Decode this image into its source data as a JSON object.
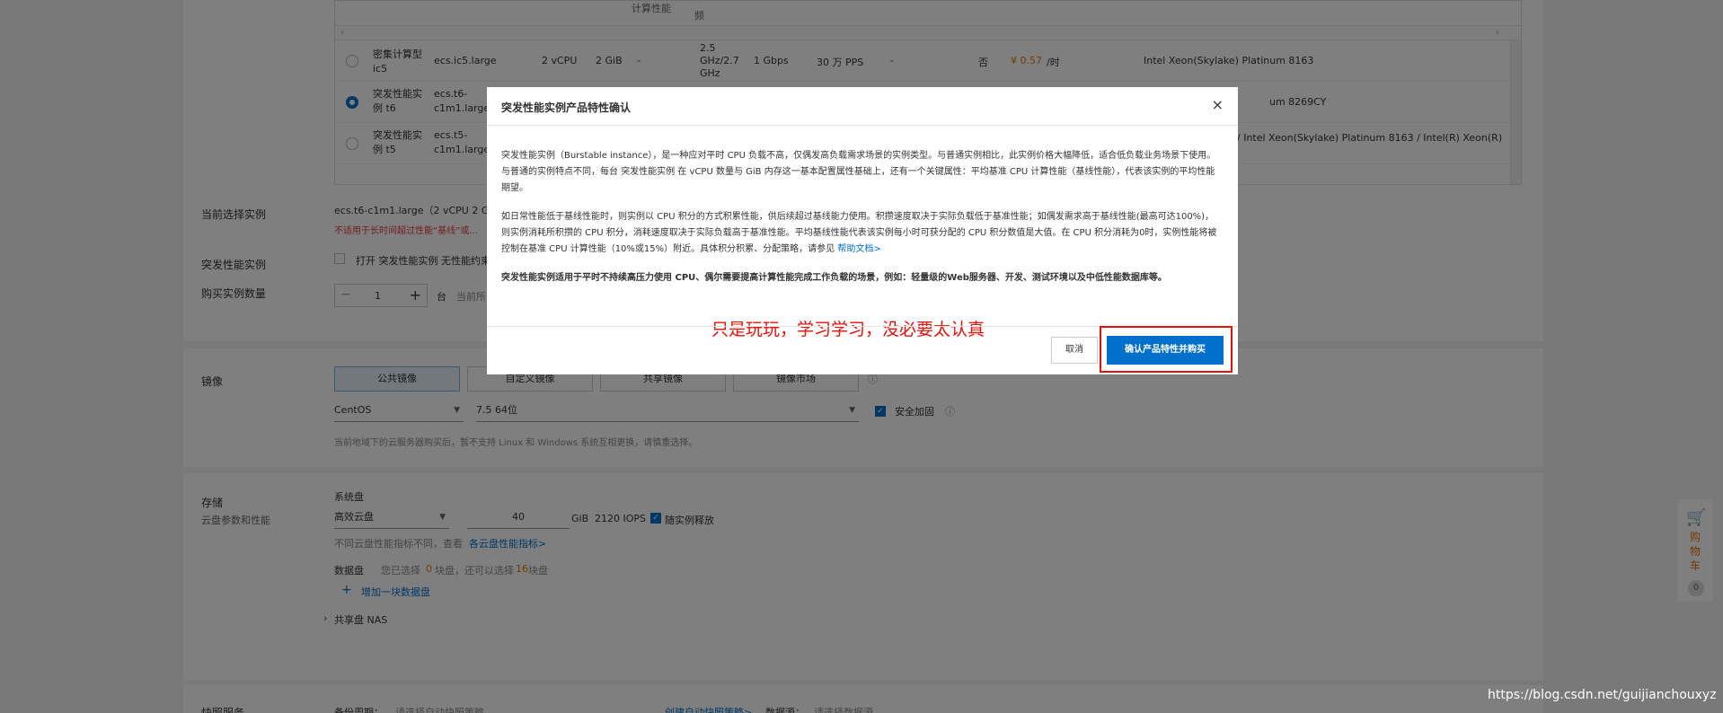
{
  "instances": {
    "header_cells": [
      "计算性能",
      "频"
    ],
    "rows": [
      {
        "name": "密集计算型 ic5",
        "spec": "ecs.ic5.large",
        "vcpu": "2 vCPU",
        "mem": "2 GiB",
        "gpu": "-",
        "freq": "2.5 GHz/2.7 GHz",
        "bw": "1 Gbps",
        "pps": "30 万 PPS",
        "extra": "-",
        "ipv6": "否",
        "price": "¥ 0.57",
        "unit": "/时",
        "cpu_model": "Intel Xeon(Skylake) Platinum 8163",
        "selected": false
      },
      {
        "name": "突发性能实例 t6",
        "spec": "ecs.t6-c1m1.large",
        "cpu_model": "um 8269CY",
        "selected": true
      },
      {
        "name": "突发性能实例 t5",
        "spec": "ecs.t5-c1m1.large",
        "cpu_model": "/ Intel Xeon(Skylake) Platinum 8163 / Intel(R) Xeon(R)",
        "selected": false
      }
    ]
  },
  "current_selection": {
    "label": "当前选择实例",
    "value": "ecs.t6-c1m1.large（2 vCPU 2 G",
    "warning": "不适用于长时间超过性能“基线”或..."
  },
  "burstable": {
    "label": "突发性能实例",
    "checkbox_label": "打开 突发性能实例 无性能约束"
  },
  "quantity": {
    "label": "购买实例数量",
    "value": "1",
    "unit": "台",
    "note": "当前所"
  },
  "image": {
    "label": "镜像",
    "tabs": [
      "公共镜像",
      "自定义镜像",
      "共享镜像",
      "镜像市场"
    ],
    "os": "CentOS",
    "version": "7.5 64位",
    "security_label": "安全加固",
    "note": "当前地域下的云服务器购买后，暂不支持 Linux 和 Windows 系统互相更换，请慎重选择。"
  },
  "storage": {
    "label": "存储",
    "sublabel": "云盘参数和性能",
    "system_disk": "系统盘",
    "disk_type": "高效云盘",
    "disk_size": "40",
    "disk_unit": "GiB",
    "iops": "2120 IOPS",
    "release_label": "随实例释放",
    "perf_note": "不同云盘性能指标不同，查看",
    "perf_link": "各云盘性能指标>",
    "data_disk": "数据盘",
    "data_disk_note_a": "您已选择",
    "data_disk_count": "0",
    "data_disk_note_b": "块盘，还可以选择",
    "data_disk_remaining": "16",
    "data_disk_note_c": "块盘",
    "add_disk": "增加一块数据盘",
    "nas": "共享盘 NAS"
  },
  "snapshot": {
    "label": "快照服务",
    "cycle_label": "备份周期：",
    "cycle_placeholder": "请选择自动快照策略",
    "create_link": "创建自动快照策略>",
    "source_label": "数据源：",
    "source_placeholder": "请选择数据源"
  },
  "modal": {
    "title": "突发性能实例产品特性确认",
    "close": "×",
    "para1": "突发性能实例（Burstable instance），是一种应对平时 CPU 负载不高，仅偶发高负载需求场景的实例类型。与普通实例相比，此实例价格大幅降低，适合低负载业务场景下使用。与普通的实例特点不同，每台 突发性能实例 在 vCPU 数量与 GiB 内存这一基本配置属性基础上，还有一个关键属性：平均基准 CPU 计算性能（基线性能），代表该实例的平均性能期望。",
    "para2": "如日常性能低于基线性能时，则实例以 CPU 积分的方式积累性能，供后续超过基线能力使用。积攒速度取决于实际负载低于基准性能；如偶发需求高于基线性能(最高可达100%)，则实例消耗所积攒的 CPU 积分，消耗速度取决于实际负载高于基准性能。平均基线性能代表该实例每小时可获分配的 CPU 积分数值是大值。在 CPU 积分消耗为0时，实例性能将被控制在基准 CPU 计算性能（10%或15%）附近。具体积分积累、分配策略，请参见",
    "help_link": "帮助文档>",
    "para3": "突发性能实例适用于平时不持续高压力使用 CPU、偶尔需要提高计算性能完成工作负载的场景，例如：轻量级的Web服务器、开发、测试环境以及中低性能数据库等。",
    "cancel": "取消",
    "confirm": "确认产品特性并购买",
    "annotation": "只是玩玩，学习学习，没必要太认真"
  },
  "cart": {
    "icon": "cart-icon",
    "label": "购物车",
    "count": "0"
  },
  "watermark": "https://blog.csdn.net/guijianchouxyz",
  "colors": {
    "primary": "#0070cc",
    "annotation_red": "#e4100a",
    "price_orange": "#e8730a"
  }
}
